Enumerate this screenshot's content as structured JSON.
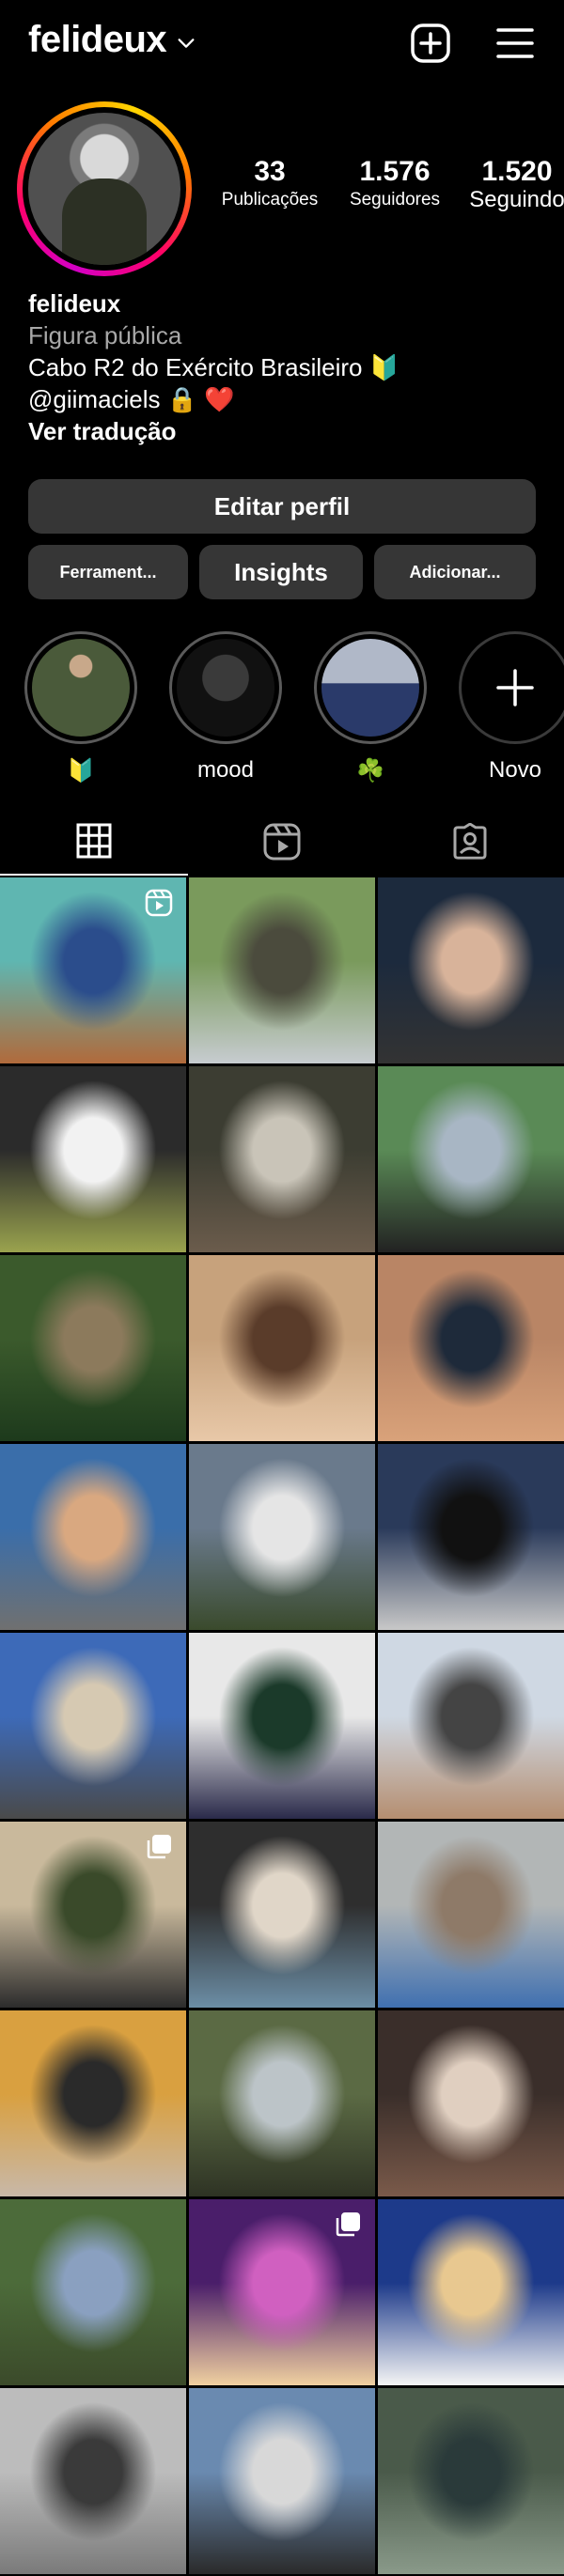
{
  "header": {
    "username": "felideux"
  },
  "profile": {
    "stats": {
      "posts_count": "33",
      "posts_label": "Publicações",
      "followers_count": "1.576",
      "followers_label": "Seguidores",
      "following_count": "1.520",
      "following_label": "Seguindo"
    },
    "bio": {
      "name": "felideux",
      "category": "Figura pública",
      "line1": "Cabo R2 do Exército Brasileiro 🔰",
      "line2": "@giimaciels 🔒 ❤️",
      "translate": "Ver tradução"
    }
  },
  "buttons": {
    "edit": "Editar perfil",
    "tools": "Ferrament...",
    "insights": "Insights",
    "add": "Adicionar..."
  },
  "highlights": [
    {
      "label": "🔰"
    },
    {
      "label": "mood"
    },
    {
      "label": "☘️"
    },
    {
      "label": "Novo"
    }
  ],
  "tabs": [
    "posts-grid",
    "reels",
    "tagged"
  ],
  "grid": {
    "posts": [
      {
        "type": "reel",
        "colors": [
          "#5fb6b1",
          "#2b4d8c",
          "#b16a3b"
        ]
      },
      {
        "type": "image",
        "colors": [
          "#7a9a5c",
          "#4b4b3d",
          "#c7ccd0"
        ]
      },
      {
        "type": "image",
        "colors": [
          "#1c2a3d",
          "#d8b39a",
          "#333333"
        ]
      },
      {
        "type": "image",
        "colors": [
          "#2b2b2b",
          "#f2f2f2",
          "#9aa34e"
        ]
      },
      {
        "type": "image",
        "colors": [
          "#3c3d32",
          "#c9c4b8",
          "#6b5c4c"
        ]
      },
      {
        "type": "image",
        "colors": [
          "#5a8a56",
          "#a8b6c4",
          "#222222"
        ]
      },
      {
        "type": "image",
        "colors": [
          "#3b5a2c",
          "#8c7a5c",
          "#1d3a1c"
        ]
      },
      {
        "type": "image",
        "colors": [
          "#c7a27c",
          "#5a3c2a",
          "#e8c8a8"
        ]
      },
      {
        "type": "image",
        "colors": [
          "#b98565",
          "#1e2a3a",
          "#d9a27a"
        ]
      },
      {
        "type": "image",
        "colors": [
          "#3a6eaa",
          "#d9a880",
          "#707070"
        ]
      },
      {
        "type": "image",
        "colors": [
          "#6a7a8c",
          "#e5e5e5",
          "#3a4a2c"
        ]
      },
      {
        "type": "image",
        "colors": [
          "#2a3a5a",
          "#111111",
          "#c8c8c8"
        ]
      },
      {
        "type": "image",
        "colors": [
          "#3d6ab8",
          "#d6c9b2",
          "#4a4a4a"
        ]
      },
      {
        "type": "image",
        "colors": [
          "#e8e8e8",
          "#1b3a2a",
          "#2a2a4a"
        ]
      },
      {
        "type": "image",
        "colors": [
          "#cfd8e3",
          "#444444",
          "#b58e70"
        ]
      },
      {
        "type": "carousel",
        "colors": [
          "#c9b99c",
          "#3a4a2a",
          "#2c2c2c"
        ]
      },
      {
        "type": "image",
        "colors": [
          "#2e2e2e",
          "#e0d6c8",
          "#6c8ea6"
        ]
      },
      {
        "type": "image",
        "colors": [
          "#b2b6b6",
          "#8e7a68",
          "#4070b0"
        ]
      },
      {
        "type": "image",
        "colors": [
          "#d9a040",
          "#2a2a2a",
          "#c8b8a8"
        ]
      },
      {
        "type": "image",
        "colors": [
          "#5b6a44",
          "#bcc4c8",
          "#2e3324"
        ]
      },
      {
        "type": "image",
        "colors": [
          "#3a2e2a",
          "#e0cfc0",
          "#7a5a4a"
        ]
      },
      {
        "type": "image",
        "colors": [
          "#4c6b3a",
          "#8aa0c0",
          "#3b4a2a"
        ]
      },
      {
        "type": "carousel",
        "colors": [
          "#4a1e6a",
          "#d060c0",
          "#f0d0a0"
        ]
      },
      {
        "type": "image",
        "colors": [
          "#1d3a8a",
          "#e8c890",
          "#f5f5f5"
        ]
      },
      {
        "type": "image",
        "colors": [
          "#bcbcbc",
          "#3a3a3a",
          "#7a7a7a"
        ]
      },
      {
        "type": "image",
        "colors": [
          "#6a8ab0",
          "#d8d8d8",
          "#2a2a2a"
        ]
      },
      {
        "type": "image",
        "colors": [
          "#4a5a4a",
          "#2a3a3a",
          "#8a9a8a"
        ]
      }
    ]
  },
  "colors": {
    "background": "#000000",
    "button": "#363636",
    "muted_text": "#a8a8a8"
  }
}
